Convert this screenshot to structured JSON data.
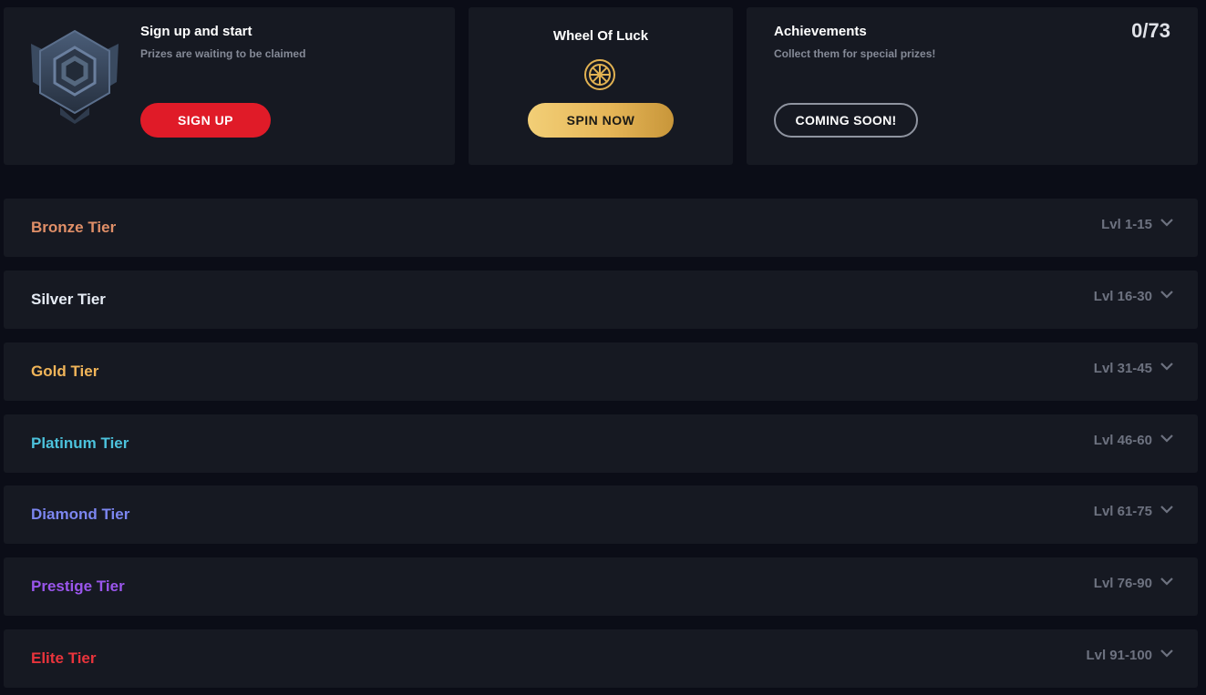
{
  "signup_card": {
    "title": "Sign up and start",
    "subtitle": "Prizes are waiting to be claimed",
    "button_label": "SIGN UP"
  },
  "wheel_card": {
    "title": "Wheel Of Luck",
    "button_label": "SPIN NOW"
  },
  "achievements_card": {
    "title": "Achievements",
    "subtitle": "Collect them for special prizes!",
    "count": "0/73",
    "button_label": "COMING SOON!"
  },
  "tiers": [
    {
      "name": "Bronze Tier",
      "levels": "Lvl 1-15",
      "color": "#e08f68"
    },
    {
      "name": "Silver Tier",
      "levels": "Lvl 16-30",
      "color": "#e6ecf5"
    },
    {
      "name": "Gold Tier",
      "levels": "Lvl 31-45",
      "color": "#f1b559"
    },
    {
      "name": "Platinum Tier",
      "levels": "Lvl 46-60",
      "color": "#4cc2dc"
    },
    {
      "name": "Diamond Tier",
      "levels": "Lvl 61-75",
      "color": "#7c86f0"
    },
    {
      "name": "Prestige Tier",
      "levels": "Lvl 76-90",
      "color": "#9a56ec"
    },
    {
      "name": "Elite Tier",
      "levels": "Lvl 91-100",
      "color": "#e9343c"
    }
  ],
  "colors": {
    "background": "#0b0d17",
    "card": "#161922",
    "signup_red": "#e01b28",
    "gold": "#e6b658"
  },
  "icons": {
    "badge": "hexagon-badge-icon",
    "wheel": "wheel-icon",
    "chevron": "chevron-down-icon"
  }
}
